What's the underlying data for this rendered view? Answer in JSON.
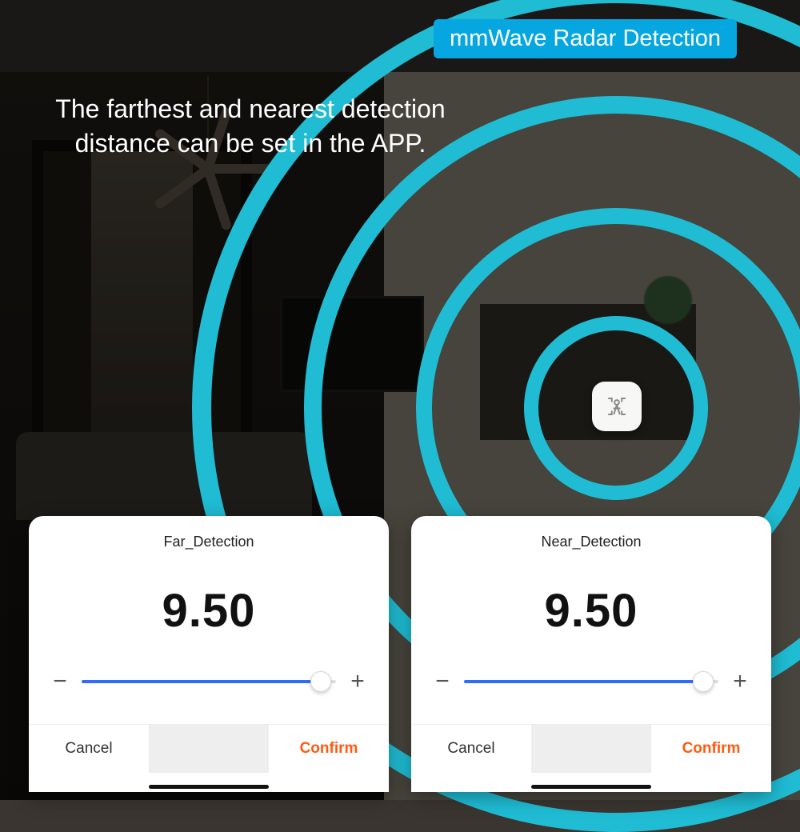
{
  "badge": {
    "label": "mmWave Radar Detection"
  },
  "headline": "The farthest and nearest detection distance can be set in the APP.",
  "colors": {
    "accent": "#06a7e1",
    "ring": "#1fbcd3",
    "slider": "#2f6bff",
    "confirm": "#ff5a10"
  },
  "sensor": {
    "icon": "presence-sensor-icon"
  },
  "cards": [
    {
      "title": "Far_Detection",
      "value": "9.50",
      "minus": "−",
      "plus": "+",
      "slider_percent": 94,
      "cancel": "Cancel",
      "confirm": "Confirm"
    },
    {
      "title": "Near_Detection",
      "value": "9.50",
      "minus": "−",
      "plus": "+",
      "slider_percent": 94,
      "cancel": "Cancel",
      "confirm": "Confirm"
    }
  ]
}
